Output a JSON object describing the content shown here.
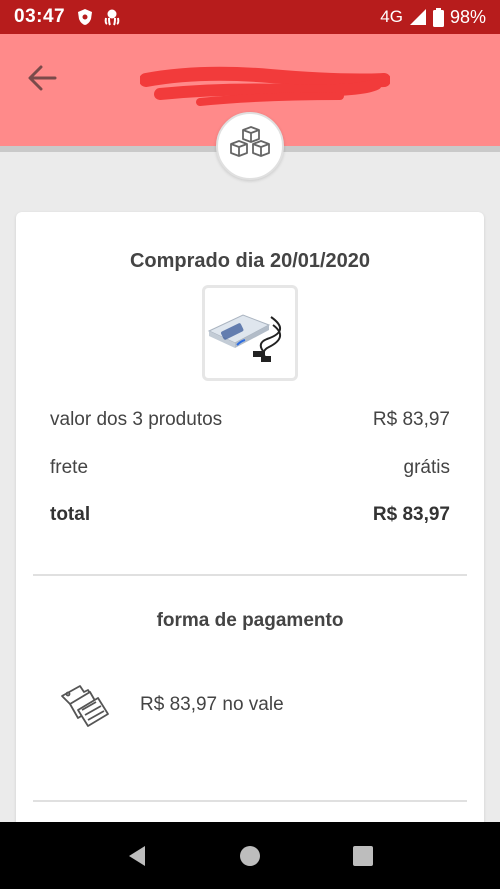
{
  "status_bar": {
    "time": "03:47",
    "network": "4G",
    "battery": "98%"
  },
  "app_bar": {
    "icons": {
      "back": "arrow-left-icon"
    }
  },
  "order": {
    "purchase_date_text": "Comprado dia 20/01/2020",
    "rows": [
      {
        "label": "valor dos 3 produtos",
        "value": "R$ 83,97"
      },
      {
        "label": "frete",
        "value": "grátis"
      },
      {
        "label": "total",
        "value": "R$ 83,97"
      }
    ]
  },
  "payment": {
    "section_title": "forma de pagamento",
    "method_text": "R$ 83,97 no vale",
    "icon": "voucher-icon"
  },
  "colors": {
    "status_bar": "#b71c1c",
    "app_bar": "#ff8a8a",
    "background": "#ebebeb"
  }
}
